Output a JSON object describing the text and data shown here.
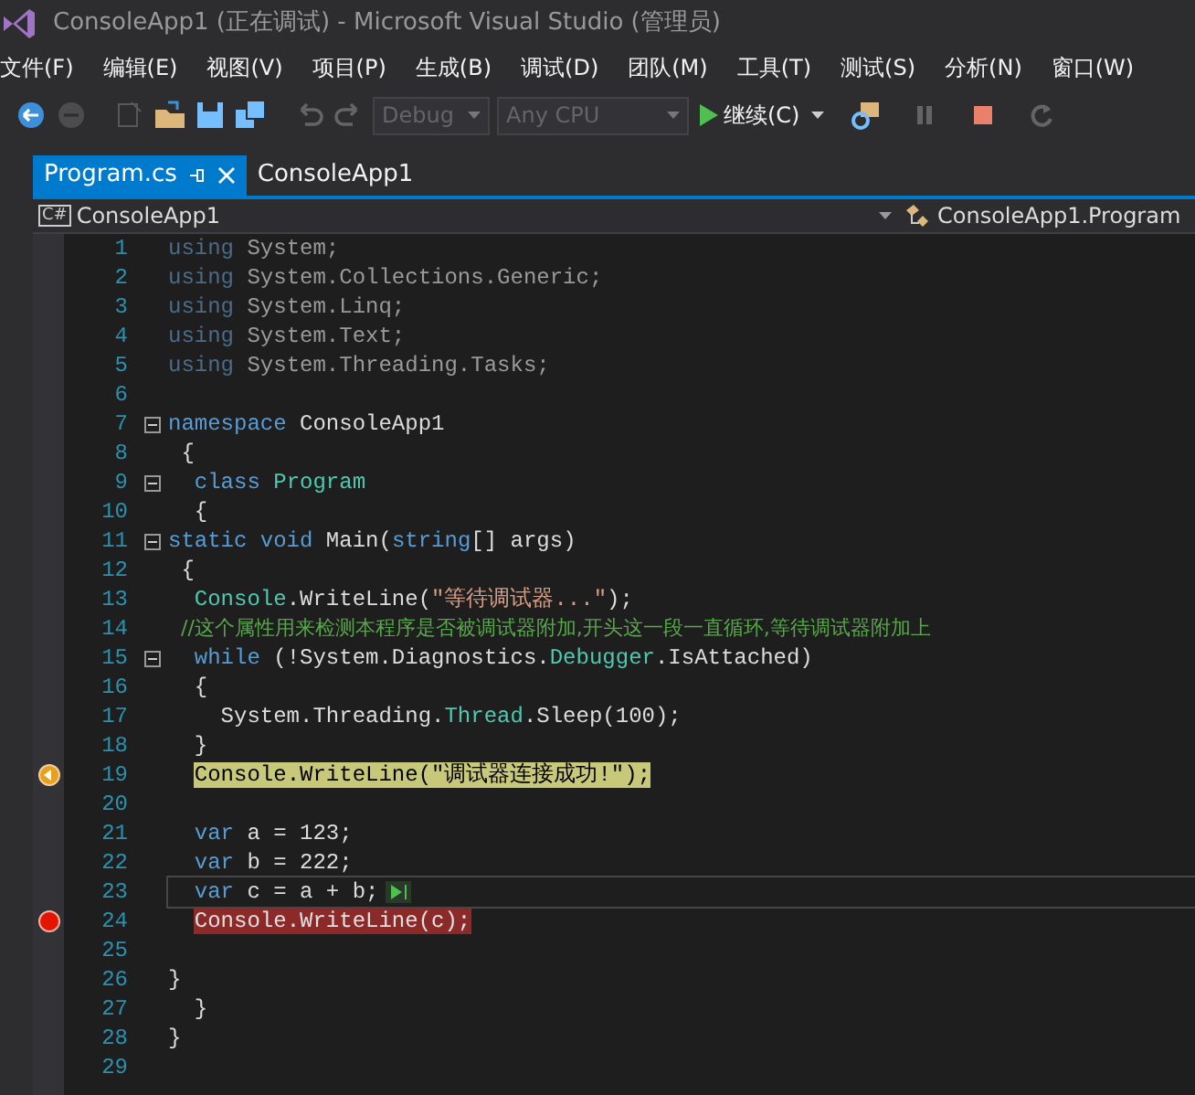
{
  "window": {
    "title": "ConsoleApp1 (正在调试) - Microsoft Visual Studio (管理员)"
  },
  "menu": [
    "文件(F)",
    "编辑(E)",
    "视图(V)",
    "项目(P)",
    "生成(B)",
    "调试(D)",
    "团队(M)",
    "工具(T)",
    "测试(S)",
    "分析(N)",
    "窗口(W)"
  ],
  "toolbar": {
    "icon_buttons": [
      {
        "disabled": false
      },
      {
        "disabled": true
      },
      {
        "disabled": true
      },
      {
        "disabled": false
      },
      {
        "disabled": false
      },
      {
        "disabled": false
      },
      {
        "disabled": true
      },
      {
        "disabled": true
      }
    ],
    "configuration": {
      "value": "Debug",
      "disabled": true
    },
    "platform": {
      "value": "Any CPU",
      "disabled": true
    },
    "continue_button": {
      "label": "继续(C)"
    },
    "debug_buttons": [
      {
        "disabled": false
      },
      {
        "disabled": true
      },
      {
        "disabled": false
      },
      {
        "disabled": true
      }
    ]
  },
  "tabs": [
    {
      "label": "Program.cs",
      "selected": true
    },
    {
      "label": "ConsoleApp1",
      "selected": false
    }
  ],
  "navigation": {
    "project_badge": "C#",
    "project": "ConsoleApp1",
    "type": "ConsoleApp1.Program"
  },
  "editor": {
    "lines": [
      {
        "number": "1",
        "kind": "normal",
        "fold": false,
        "tokens": [
          {
            "text": "using",
            "kind": "unused"
          },
          {
            "text": " System;",
            "kind": "unusedtext"
          }
        ]
      },
      {
        "number": "2",
        "kind": "normal",
        "fold": false,
        "tokens": [
          {
            "text": "using",
            "kind": "unused"
          },
          {
            "text": " System.Collections.Generic;",
            "kind": "unusedtext"
          }
        ]
      },
      {
        "number": "3",
        "kind": "normal",
        "fold": false,
        "tokens": [
          {
            "text": "using",
            "kind": "unused"
          },
          {
            "text": " System.Linq;",
            "kind": "unusedtext"
          }
        ]
      },
      {
        "number": "4",
        "kind": "normal",
        "fold": false,
        "tokens": [
          {
            "text": "using",
            "kind": "unused"
          },
          {
            "text": " System.Text;",
            "kind": "unusedtext"
          }
        ]
      },
      {
        "number": "5",
        "kind": "normal",
        "fold": false,
        "tokens": [
          {
            "text": "using",
            "kind": "unused"
          },
          {
            "text": " System.Threading.Tasks;",
            "kind": "unusedtext"
          }
        ]
      },
      {
        "number": "6",
        "kind": "normal",
        "fold": false
      },
      {
        "number": "7",
        "kind": "normal",
        "fold": true,
        "tokens": [
          {
            "text": "namespace",
            "kind": "keyword"
          },
          {
            "text": " ConsoleApp1",
            "kind": "plain"
          }
        ]
      },
      {
        "number": "8",
        "kind": "normal",
        "fold": false,
        "tokens": [
          {
            "text": " {",
            "kind": "plain"
          }
        ]
      },
      {
        "number": "9",
        "kind": "normal",
        "fold": true,
        "tokens": [
          {
            "text": "  class",
            "kind": "keyword"
          },
          {
            "text": " Program",
            "kind": "type"
          }
        ]
      },
      {
        "number": "10",
        "kind": "normal",
        "fold": false,
        "tokens": [
          {
            "text": "  {",
            "kind": "plain"
          }
        ]
      },
      {
        "number": "11",
        "kind": "normal",
        "fold": true,
        "tokens": [
          {
            "text": "static void",
            "kind": "keyword"
          },
          {
            "text": " Main(",
            "kind": "plain"
          },
          {
            "text": "string",
            "kind": "keyword"
          },
          {
            "text": "[] args)",
            "kind": "plain"
          }
        ]
      },
      {
        "number": "12",
        "kind": "normal",
        "fold": false,
        "tokens": [
          {
            "text": " {",
            "kind": "plain"
          }
        ]
      },
      {
        "number": "13",
        "kind": "normal",
        "fold": false,
        "tokens": [
          {
            "text": "  Console",
            "kind": "type"
          },
          {
            "text": ".WriteLine(",
            "kind": "plain"
          },
          {
            "text": "\"等待调试器...\"",
            "kind": "string"
          },
          {
            "text": ");",
            "kind": "plain"
          }
        ]
      },
      {
        "number": "14",
        "kind": "normal",
        "fold": false,
        "tokens": [
          {
            "text": "  //这个属性用来检测本程序是否被调试器附加,开头这一段一直循环,等待调试器附加上",
            "kind": "comment"
          }
        ]
      },
      {
        "number": "15",
        "kind": "normal",
        "fold": true,
        "tokens": [
          {
            "text": "  while",
            "kind": "keyword"
          },
          {
            "text": " (!System.Diagnostics.",
            "kind": "plain"
          },
          {
            "text": "Debugger",
            "kind": "type"
          },
          {
            "text": ".IsAttached)",
            "kind": "plain"
          }
        ]
      },
      {
        "number": "16",
        "kind": "normal",
        "fold": false,
        "tokens": [
          {
            "text": "  {",
            "kind": "plain"
          }
        ]
      },
      {
        "number": "17",
        "kind": "normal",
        "fold": false,
        "tokens": [
          {
            "text": "    System.Threading.",
            "kind": "plain"
          },
          {
            "text": "Thread",
            "kind": "type"
          },
          {
            "text": ".Sleep(100);",
            "kind": "plain"
          }
        ]
      },
      {
        "number": "18",
        "kind": "normal",
        "fold": false,
        "tokens": [
          {
            "text": "  }",
            "kind": "plain"
          }
        ]
      },
      {
        "number": "19",
        "kind": "current",
        "fold": false,
        "tokens": [
          {
            "text": "  Console.WriteLine(\"调试器连接成功!\");",
            "kind": "plain"
          }
        ]
      },
      {
        "number": "20",
        "kind": "normal",
        "fold": false
      },
      {
        "number": "21",
        "kind": "normal",
        "fold": false,
        "tokens": [
          {
            "text": "  var",
            "kind": "keyword"
          },
          {
            "text": " a = 123;",
            "kind": "plain"
          }
        ]
      },
      {
        "number": "22",
        "kind": "normal",
        "fold": false,
        "tokens": [
          {
            "text": "  var",
            "kind": "keyword"
          },
          {
            "text": " b = 222;",
            "kind": "plain"
          }
        ]
      },
      {
        "number": "23",
        "kind": "caret",
        "fold": false,
        "tokens": [
          {
            "text": "  var",
            "kind": "keyword"
          },
          {
            "text": " c = a + b;",
            "kind": "plain"
          }
        ]
      },
      {
        "number": "24",
        "kind": "breakpoint",
        "fold": false,
        "tokens": [
          {
            "text": "  Console.WriteLine(c);",
            "kind": "plain"
          }
        ]
      },
      {
        "number": "25",
        "kind": "normal",
        "fold": false
      },
      {
        "number": "26",
        "kind": "normal",
        "fold": false,
        "tokens": [
          {
            "text": "}",
            "kind": "plain"
          }
        ]
      },
      {
        "number": "27",
        "kind": "normal",
        "fold": false,
        "tokens": [
          {
            "text": "  }",
            "kind": "plain"
          }
        ]
      },
      {
        "number": "28",
        "kind": "normal",
        "fold": false,
        "tokens": [
          {
            "text": "}",
            "kind": "plain"
          }
        ]
      },
      {
        "number": "29",
        "kind": "normal",
        "fold": false
      }
    ]
  }
}
